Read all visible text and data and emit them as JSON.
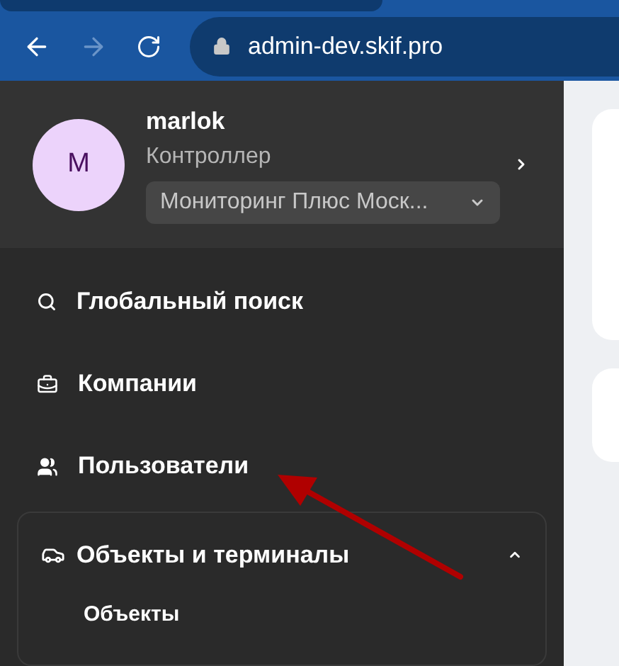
{
  "browser": {
    "url": "admin-dev.skif.pro"
  },
  "user": {
    "initial": "M",
    "name": "marlok",
    "role": "Контроллер",
    "company": "Мониторинг Плюс Моск..."
  },
  "nav": [
    {
      "kind": "search",
      "label": "Глобальный поиск"
    },
    {
      "kind": "companies",
      "label": "Компании"
    },
    {
      "kind": "users",
      "label": "Пользователи"
    }
  ],
  "group": {
    "label": "Объекты и терминалы",
    "expanded": true,
    "children": [
      {
        "label": "Объекты"
      }
    ]
  }
}
